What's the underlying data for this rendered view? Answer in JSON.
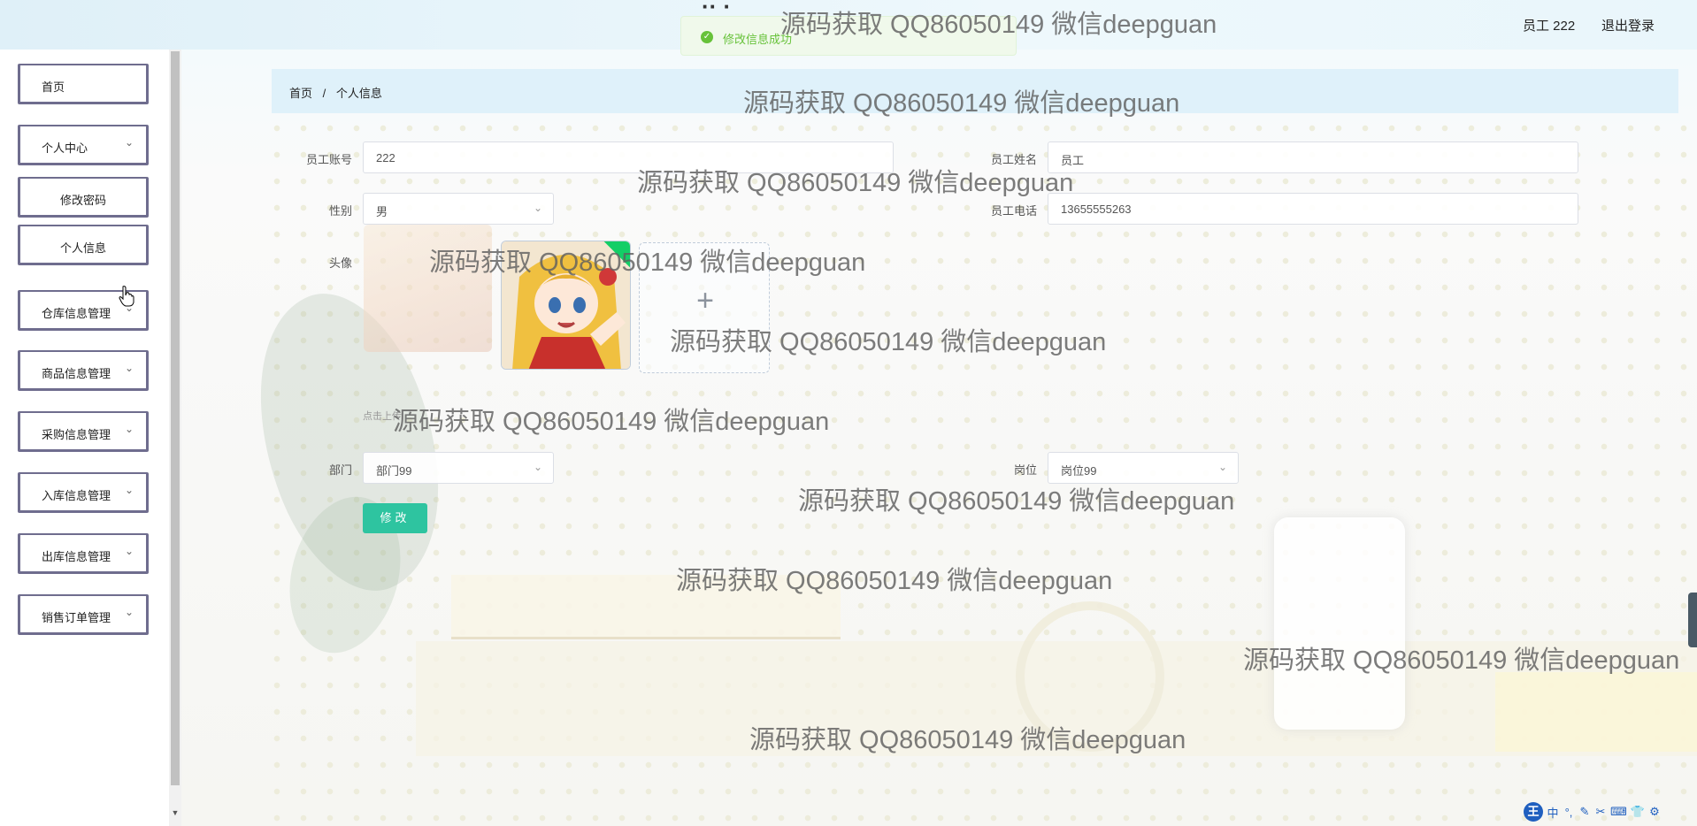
{
  "header": {
    "title_fragment": "·· ·",
    "user_label": "员工 222",
    "logout_label": "退出登录"
  },
  "toast": {
    "message": "修改信息成功",
    "icon": "check-circle-icon",
    "color": "#67c23a"
  },
  "sidebar": {
    "items": [
      {
        "label": "首页",
        "has_chevron": false,
        "sub": false
      },
      {
        "label": "个人中心",
        "has_chevron": true,
        "sub": false
      },
      {
        "label": "修改密码",
        "has_chevron": false,
        "sub": true
      },
      {
        "label": "个人信息",
        "has_chevron": false,
        "sub": true
      },
      {
        "label": "仓库信息管理",
        "has_chevron": true,
        "sub": false
      },
      {
        "label": "商品信息管理",
        "has_chevron": true,
        "sub": false
      },
      {
        "label": "采购信息管理",
        "has_chevron": true,
        "sub": false
      },
      {
        "label": "入库信息管理",
        "has_chevron": true,
        "sub": false
      },
      {
        "label": "出库信息管理",
        "has_chevron": true,
        "sub": false
      },
      {
        "label": "销售订单管理",
        "has_chevron": true,
        "sub": false
      }
    ],
    "chevron_icon": "⌄"
  },
  "breadcrumb": {
    "home": "首页",
    "separator": "/",
    "current": "个人信息"
  },
  "form": {
    "account_label": "员工账号",
    "account_value": "222",
    "name_label": "员工姓名",
    "name_value": "员工",
    "gender_label": "性别",
    "gender_value": "男",
    "phone_label": "员工电话",
    "phone_value": "13655555263",
    "avatar_label": "头像",
    "upload_tip": "点击上传",
    "department_label": "部门",
    "department_value": "部门99",
    "position_label": "岗位",
    "position_value": "岗位99",
    "submit_label": "修改"
  },
  "watermark_text": "源码获取 QQ86050149 微信deepguan",
  "ime_toolbar": {
    "logo": "王",
    "items": [
      "中",
      "°,",
      "✎",
      "✂",
      "⌨",
      "👕",
      "⚙"
    ]
  },
  "colors": {
    "accent": "#2ec4a0",
    "sidebar_border": "#6f6d8e",
    "breadcrumb_bg": "#dff1fa",
    "success": "#67c23a"
  }
}
